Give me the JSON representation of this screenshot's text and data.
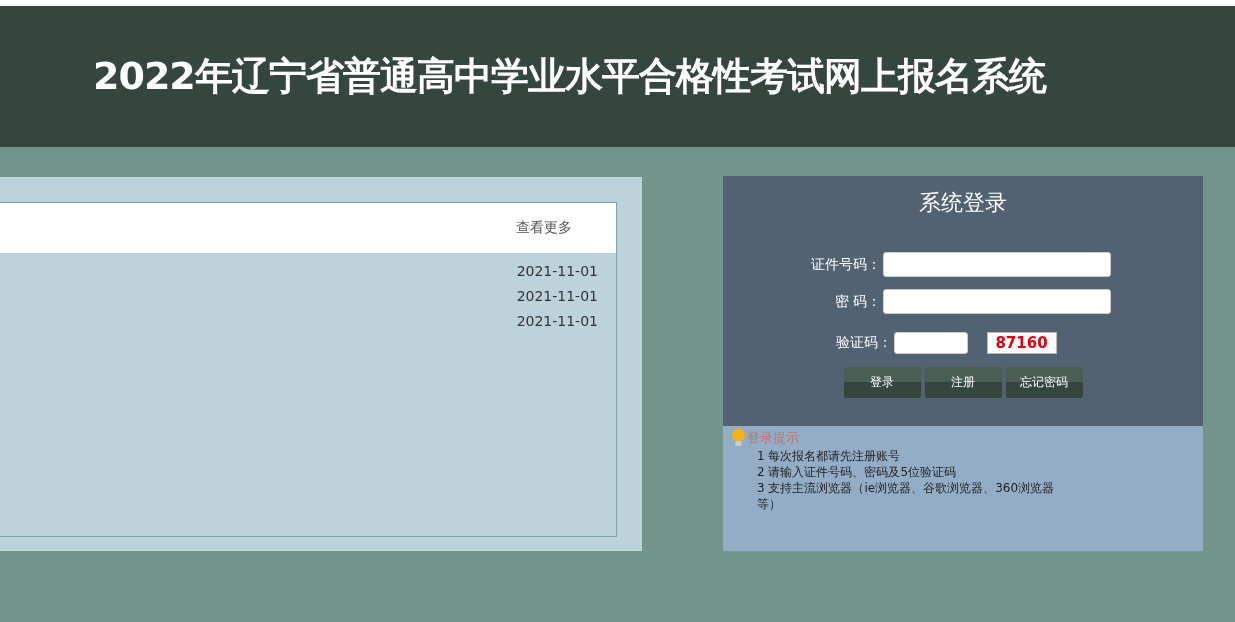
{
  "header": {
    "title": "2022年辽宁省普通高中学业水平合格性考试网上报名系统"
  },
  "news": {
    "more_link": "查看更多",
    "items": [
      {
        "date": "2021-11-01"
      },
      {
        "date": "2021-11-01"
      },
      {
        "date": "2021-11-01"
      }
    ]
  },
  "login": {
    "title": "系统登录",
    "fields": [
      {
        "kind": "text",
        "label": "证件号码："
      },
      {
        "kind": "password",
        "label": "密 码："
      },
      {
        "kind": "captcha",
        "label": "验证码：",
        "captcha_code": "87160"
      }
    ],
    "buttons": [
      "登录",
      "注册",
      "忘记密码"
    ]
  },
  "tips": {
    "title": "登录提示",
    "lines": [
      "1 每次报名都请先注册账号",
      "2 请输入证件号码、密码及5位验证码",
      "3 支持主流浏览器（ie浏览器、谷歌浏览器、360浏览器等）"
    ]
  }
}
